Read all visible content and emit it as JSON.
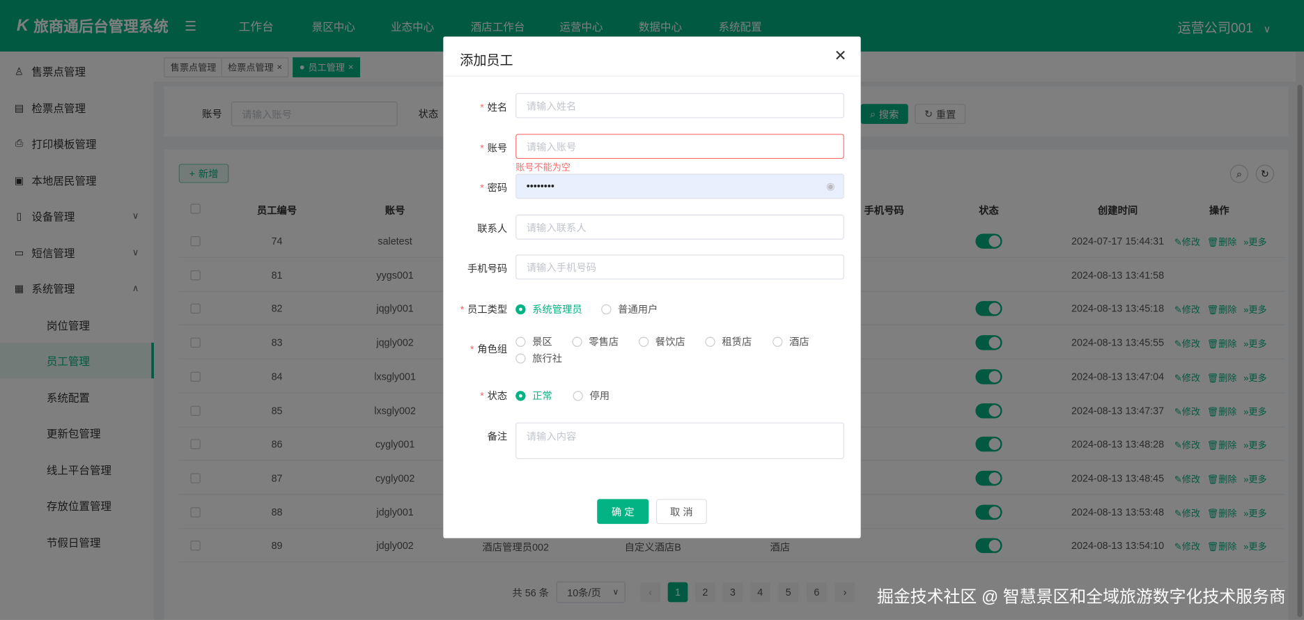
{
  "header": {
    "logo": "旅商通后台管理系统",
    "nav": [
      "工作台",
      "景区中心",
      "业态中心",
      "酒店工作台",
      "运营中心",
      "数据中心",
      "系统配置"
    ],
    "user": "运营公司001"
  },
  "sidebar": {
    "items": [
      {
        "label": "售票点管理",
        "icon": "user-icon"
      },
      {
        "label": "检票点管理",
        "icon": "ticket-icon"
      },
      {
        "label": "打印模板管理",
        "icon": "print-icon"
      },
      {
        "label": "本地居民管理",
        "icon": "resident-icon"
      },
      {
        "label": "设备管理",
        "icon": "device-icon",
        "expand": "down"
      },
      {
        "label": "短信管理",
        "icon": "message-icon",
        "expand": "down"
      },
      {
        "label": "系统管理",
        "icon": "system-icon",
        "expand": "up"
      }
    ],
    "sub_items": [
      "岗位管理",
      "员工管理",
      "系统配置",
      "更新包管理",
      "线上平台管理",
      "存放位置管理",
      "节假日管理"
    ],
    "active": "员工管理"
  },
  "tabs": [
    {
      "label": "售票点管理",
      "closable": false
    },
    {
      "label": "检票点管理",
      "closable": true
    },
    {
      "label": "员工管理",
      "closable": true,
      "active": true
    }
  ],
  "search": {
    "account_label": "账号",
    "account_placeholder": "请输入账号",
    "status_label": "状态",
    "search_btn": "搜索",
    "reset_btn": "重置"
  },
  "table": {
    "add_btn": "新增",
    "headers": {
      "id": "员工编号",
      "account": "账号",
      "phone": "手机号码",
      "status": "状态",
      "created": "创建时间",
      "ops": "操作"
    },
    "ops": {
      "edit": "修改",
      "delete": "删除",
      "more": "更多"
    },
    "rows": [
      {
        "id": "74",
        "account": "saletest",
        "status": true,
        "created": "2024-07-17 15:44:31",
        "ops": true
      },
      {
        "id": "81",
        "account": "yygs001",
        "status": null,
        "created": "2024-08-13 13:41:58",
        "ops": false
      },
      {
        "id": "82",
        "account": "jqgly001",
        "status": true,
        "created": "2024-08-13 13:45:18",
        "ops": true
      },
      {
        "id": "83",
        "account": "jqgly002",
        "status": true,
        "created": "2024-08-13 13:45:55",
        "ops": true
      },
      {
        "id": "84",
        "account": "lxsgly001",
        "status": true,
        "created": "2024-08-13 13:47:04",
        "ops": true
      },
      {
        "id": "85",
        "account": "lxsgly002",
        "status": true,
        "created": "2024-08-13 13:47:37",
        "ops": true
      },
      {
        "id": "86",
        "account": "cygly001",
        "status": true,
        "created": "2024-08-13 13:48:28",
        "ops": true
      },
      {
        "id": "87",
        "account": "cygly002",
        "status": true,
        "created": "2024-08-13 13:48:45",
        "ops": true
      },
      {
        "id": "88",
        "account": "jdgly001",
        "status": true,
        "created": "2024-08-13 13:53:48",
        "ops": true
      },
      {
        "id": "89",
        "account": "jdgly002",
        "name": "酒店管理员002",
        "org": "自定义酒店B",
        "type": "酒店",
        "status": true,
        "created": "2024-08-13 13:54:10",
        "ops": true
      }
    ]
  },
  "pagination": {
    "total": "共 56 条",
    "page_size": "10条/页",
    "pages": [
      "1",
      "2",
      "3",
      "4",
      "5",
      "6"
    ],
    "current": "1"
  },
  "modal": {
    "title": "添加员工",
    "fields": {
      "name": {
        "label": "姓名",
        "placeholder": "请输入姓名"
      },
      "account": {
        "label": "账号",
        "placeholder": "请输入账号",
        "error": "账号不能为空"
      },
      "password": {
        "label": "密码",
        "value": "••••••••"
      },
      "contact": {
        "label": "联系人",
        "placeholder": "请输入联系人"
      },
      "phone": {
        "label": "手机号码",
        "placeholder": "请输入手机号码"
      },
      "staff_type": {
        "label": "员工类型",
        "options": [
          "系统管理员",
          "普通用户"
        ],
        "selected": "系统管理员"
      },
      "role_group": {
        "label": "角色组",
        "options": [
          "景区",
          "零售店",
          "餐饮店",
          "租赁店",
          "酒店",
          "旅行社"
        ]
      },
      "status": {
        "label": "状态",
        "options": [
          "正常",
          "停用"
        ],
        "selected": "正常"
      },
      "remark": {
        "label": "备注",
        "placeholder": "请输入内容"
      }
    },
    "confirm": "确 定",
    "cancel": "取 消"
  },
  "watermark": "掘金技术社区 @ 智慧景区和全域旅游数字化技术服务商",
  "colors": {
    "primary": "#04b383",
    "error": "#f56c6c"
  }
}
